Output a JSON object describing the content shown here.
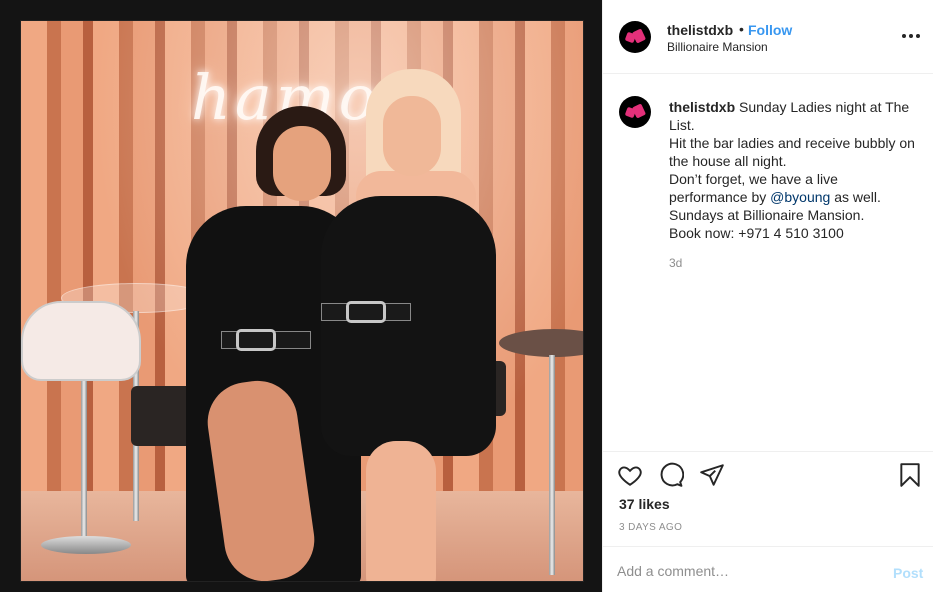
{
  "post": {
    "photo_neon_text": "hamor",
    "header": {
      "username": "thelistdxb",
      "separator": "•",
      "follow_label": "Follow",
      "location": "Billionaire Mansion",
      "more_icon": "more-horizontal-icon"
    },
    "caption": {
      "username": "thelistdxb",
      "line1": "Sunday Ladies night at The List.",
      "line2": "Hit the bar ladies and receive bubbly on the house all night.",
      "line3_pre": "Don’t forget, we have a live performance by ",
      "line3_mention": "@byoung",
      "line3_post": " as well.",
      "line4": "Sundays at Billionaire Mansion.",
      "line5": "Book now: +971 4 510 3100",
      "time": "3d"
    },
    "actions": {
      "like_icon": "heart-icon",
      "comment_icon": "comment-icon",
      "share_icon": "share-icon",
      "save_icon": "bookmark-icon"
    },
    "likes": "37 likes",
    "posted_ago": "3 DAYS AGO",
    "comment": {
      "placeholder": "Add a comment…",
      "post_label": "Post"
    }
  },
  "colors": {
    "link": "#3897f0",
    "mention": "#00376b",
    "post_disabled": "#b2dffc",
    "avatar_mark": "#e4307a"
  }
}
